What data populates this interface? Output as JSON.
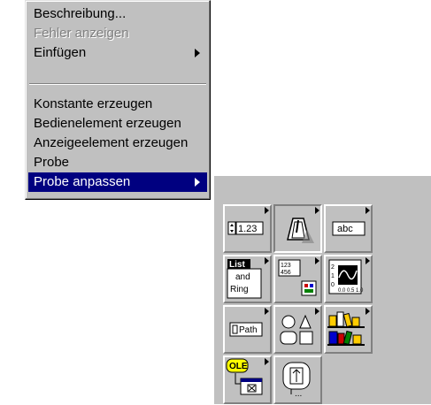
{
  "menu": {
    "items": [
      {
        "label": "Beschreibung...",
        "disabled": false,
        "submenu": false
      },
      {
        "label": "Fehler anzeigen",
        "disabled": true,
        "submenu": false
      },
      {
        "label": "Einfügen",
        "disabled": false,
        "submenu": true
      },
      {
        "label": "Konstante erzeugen",
        "disabled": false,
        "submenu": false
      },
      {
        "label": "Bedienelement erzeugen",
        "disabled": false,
        "submenu": false
      },
      {
        "label": "Anzeigeelement erzeugen",
        "disabled": false,
        "submenu": false
      },
      {
        "label": "Probe",
        "disabled": false,
        "submenu": false
      },
      {
        "label": "Probe anpassen",
        "disabled": false,
        "submenu": true,
        "selected": true
      }
    ]
  },
  "palette": {
    "tiles": [
      {
        "name": "numeric",
        "text": "1.23"
      },
      {
        "name": "boolean",
        "text": ""
      },
      {
        "name": "string",
        "text": "abc"
      },
      {
        "name": "list-ring",
        "text_lines": [
          "List",
          "and",
          "Ring"
        ]
      },
      {
        "name": "array-cluster",
        "text": ""
      },
      {
        "name": "graph",
        "text": ""
      },
      {
        "name": "path",
        "text": "Path"
      },
      {
        "name": "decorations",
        "text": ""
      },
      {
        "name": "controls-library",
        "text": ""
      },
      {
        "name": "activex",
        "text": "OLE"
      },
      {
        "name": "refnum",
        "text": ""
      }
    ]
  },
  "colors": {
    "menu_bg": "#c0c0c0",
    "highlight": "#000080",
    "disabled_text": "#808080"
  }
}
